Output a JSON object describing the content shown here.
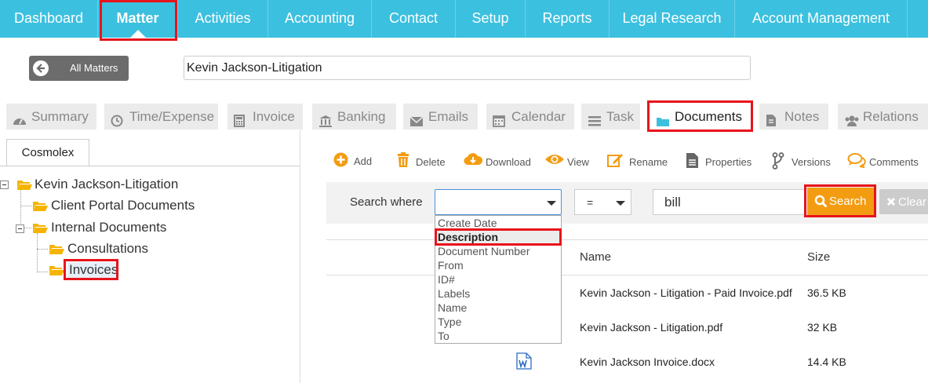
{
  "top_nav": {
    "items": [
      "Dashboard",
      "Matter",
      "Activities",
      "Accounting",
      "Contact",
      "Setup",
      "Reports",
      "Legal Research",
      "Account Management"
    ],
    "active": "Matter"
  },
  "header": {
    "back_button_label": "All Matters",
    "matter_name": "Kevin Jackson-Litigation"
  },
  "tabs": [
    "Summary",
    "Time/Expense",
    "Invoice",
    "Banking",
    "Emails",
    "Calendar",
    "Task",
    "Documents",
    "Notes",
    "Relations"
  ],
  "active_tab": "Documents",
  "sidebar": {
    "tab_label": "Cosmolex",
    "tree": {
      "root": "Kevin Jackson-Litigation",
      "client_portal": "Client Portal Documents",
      "internal": "Internal Documents",
      "consultations": "Consultations",
      "invoices": "Invoices"
    }
  },
  "toolbar": {
    "add": "Add",
    "delete": "Delete",
    "download": "Download",
    "view": "View",
    "rename": "Rename",
    "properties": "Properties",
    "versions": "Versions",
    "comments": "Comments"
  },
  "search": {
    "where_label": "Search where",
    "field_value": "",
    "operator": "=",
    "query": "bill",
    "search_button": "Search",
    "clear_button": "Clear",
    "dropdown_options": [
      "Create Date",
      "Description",
      "Document Number",
      "From",
      "ID#",
      "Labels",
      "Name",
      "Type",
      "To"
    ],
    "highlighted_option": "Description"
  },
  "table": {
    "headers": {
      "name": "Name",
      "size": "Size"
    },
    "rows": [
      {
        "name": "Kevin Jackson - Litigation - Paid Invoice.pdf",
        "size": "36.5 KB"
      },
      {
        "name": "Kevin Jackson - Litigation.pdf",
        "size": "32 KB"
      },
      {
        "name": "Kevin Jackson Invoice.docx",
        "size": "14.4 KB"
      }
    ]
  },
  "colors": {
    "nav_bg": "#3cc0df",
    "highlight_red": "#e8141b",
    "search_orange": "#f39c12",
    "folder_yellow": "#f5b400",
    "toolbar_orange": "#f39c12"
  }
}
